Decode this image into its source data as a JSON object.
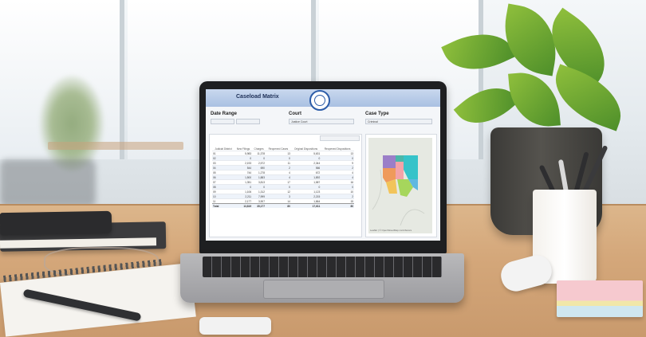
{
  "app": {
    "title": "Caseload Matrix"
  },
  "filters": {
    "date_range": {
      "label": "Date Range",
      "start": "",
      "end": ""
    },
    "court": {
      "label": "Court",
      "value": "Justice Court"
    },
    "case_type": {
      "label": "Case Type",
      "value": "Criminal"
    }
  },
  "table": {
    "headers": [
      "Judicial District",
      "New Filings",
      "Charges",
      "Reopened Cases",
      "Original Dispositions",
      "Reopened Dispositions"
    ],
    "rows": [
      [
        "01",
        "5,983",
        "11,378",
        "13",
        "5,631",
        "13"
      ],
      [
        "02",
        "0",
        "0",
        "0",
        "0",
        "0"
      ],
      [
        "03",
        "2,193",
        "2,572",
        "11",
        "2,344",
        "9"
      ],
      [
        "04",
        "544",
        "690",
        "2",
        "566",
        "2"
      ],
      [
        "05",
        "744",
        "1,278",
        "4",
        "672",
        "4"
      ],
      [
        "06",
        "1,500",
        "1,883",
        "4",
        "1,892",
        "4"
      ],
      [
        "07",
        "1,351",
        "3,813",
        "17",
        "1,587",
        "16"
      ],
      [
        "08",
        "0",
        "0",
        "0",
        "0",
        "0"
      ],
      [
        "09",
        "1,106",
        "1,312",
        "12",
        "1,123",
        "10"
      ],
      [
        "10",
        "2,211",
        "7,999",
        "3",
        "2,215",
        "2"
      ],
      [
        "11",
        "2,177",
        "3,907",
        "14",
        "1,864",
        "15"
      ]
    ],
    "total": [
      "Total",
      "13,819",
      "35,177",
      "80",
      "17,611",
      "80"
    ]
  },
  "map": {
    "attribution": "Leaflet | © OpenStreetMap contributors"
  },
  "colors": {
    "header_bg": "#a9c0e2",
    "title_text": "#1c2e55",
    "seal": "#2d5da8",
    "desk": "#d4a77a"
  }
}
